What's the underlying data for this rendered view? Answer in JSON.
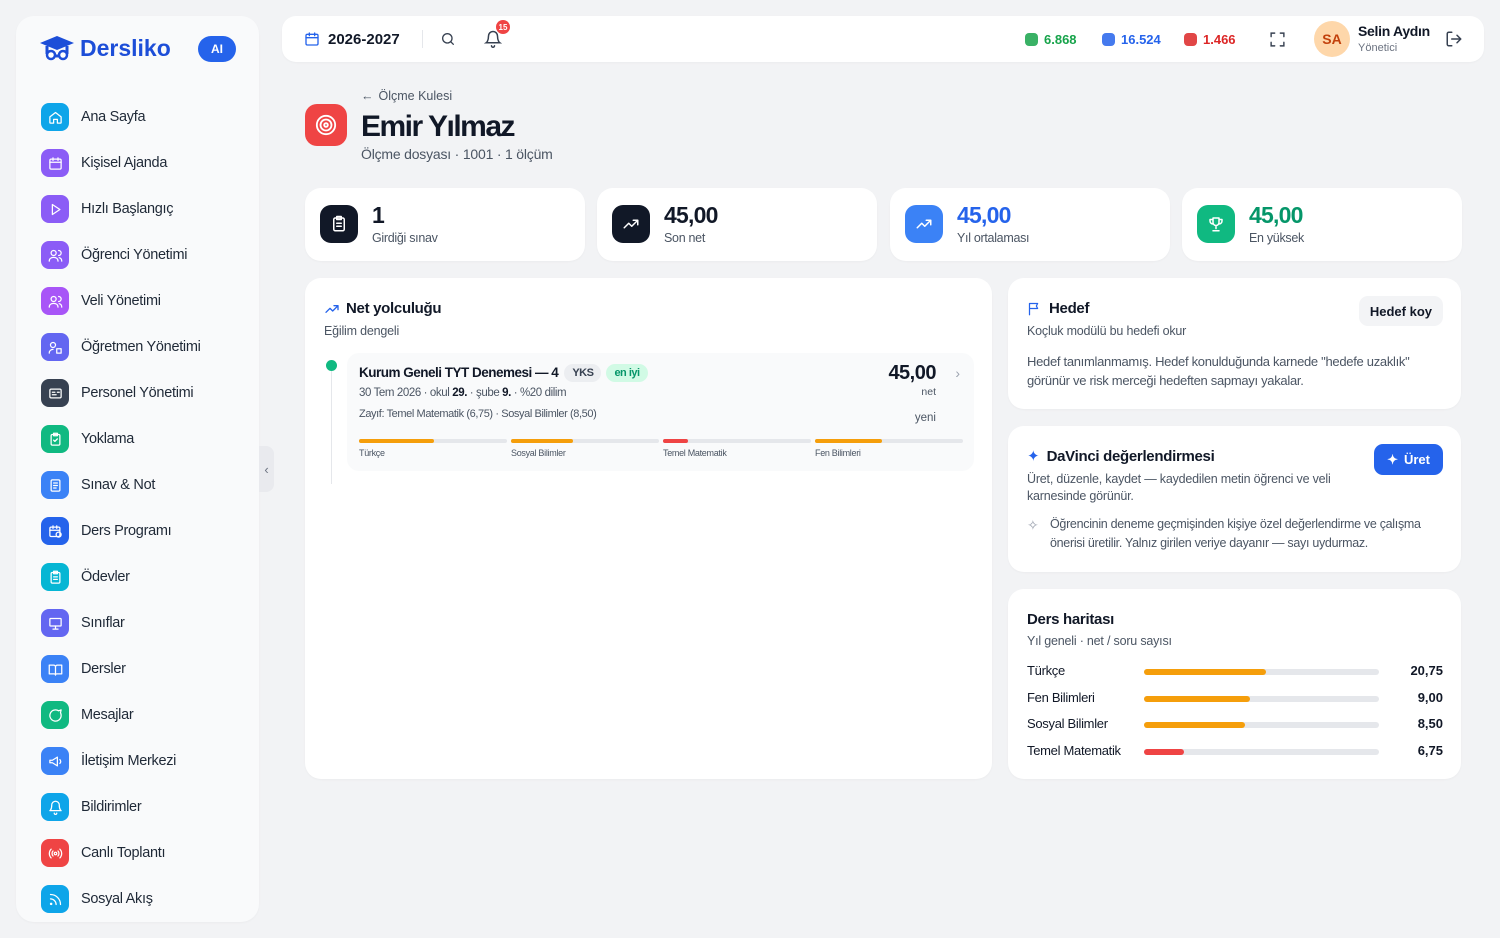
{
  "brand": {
    "name": "Dersliko",
    "ai_label": "AI"
  },
  "sidebar": {
    "items": [
      {
        "label": "Ana Sayfa",
        "icon": "home-icon",
        "color": "#0ea5e9"
      },
      {
        "label": "Kişisel Ajanda",
        "icon": "calendar-icon",
        "color": "#8b5cf6"
      },
      {
        "label": "Hızlı Başlangıç",
        "icon": "play-icon",
        "color": "#8b5cf6"
      },
      {
        "label": "Öğrenci Yönetimi",
        "icon": "users-icon",
        "color": "#8b5cf6"
      },
      {
        "label": "Veli Yönetimi",
        "icon": "users-icon",
        "color": "#a855f7"
      },
      {
        "label": "Öğretmen Yönetimi",
        "icon": "teacher-icon",
        "color": "#6366f1"
      },
      {
        "label": "Personel Yönetimi",
        "icon": "id-card-icon",
        "color": "#374151"
      },
      {
        "label": "Yoklama",
        "icon": "clipboard-check-icon",
        "color": "#10b981"
      },
      {
        "label": "Sınav & Not",
        "icon": "document-icon",
        "color": "#3b82f6"
      },
      {
        "label": "Ders Programı",
        "icon": "calendar-clock-icon",
        "color": "#2563eb"
      },
      {
        "label": "Ödevler",
        "icon": "clipboard-icon",
        "color": "#06b6d4"
      },
      {
        "label": "Sınıflar",
        "icon": "presentation-icon",
        "color": "#6366f1"
      },
      {
        "label": "Dersler",
        "icon": "book-icon",
        "color": "#3b82f6"
      },
      {
        "label": "Mesajlar",
        "icon": "message-icon",
        "color": "#10b981"
      },
      {
        "label": "İletişim Merkezi",
        "icon": "megaphone-icon",
        "color": "#3b82f6"
      },
      {
        "label": "Bildirimler",
        "icon": "bell-icon",
        "color": "#0ea5e9"
      },
      {
        "label": "Canlı Toplantı",
        "icon": "broadcast-icon",
        "color": "#ef4444"
      },
      {
        "label": "Sosyal Akış",
        "icon": "rss-icon",
        "color": "#0ea5e9"
      }
    ]
  },
  "topbar": {
    "year": "2026-2027",
    "notification_count": "15",
    "stats": [
      {
        "value": "6.868",
        "color": "#16a34a",
        "icon": "gem-green-icon"
      },
      {
        "value": "16.524",
        "color": "#2563eb",
        "icon": "gem-blue-icon"
      },
      {
        "value": "1.466",
        "color": "#dc2626",
        "icon": "gem-red-icon"
      }
    ],
    "user": {
      "initials": "SA",
      "name": "Selin Aydın",
      "role": "Yönetici"
    }
  },
  "page": {
    "back_label": "Ölçme Kulesi",
    "title": "Emir Yılmaz",
    "subtitle": "Ölçme dosyası · 1001 · 1 ölçüm"
  },
  "kpis": [
    {
      "value": "1",
      "label": "Girdiği sınav",
      "color": "#111827",
      "icon": "clipboard-icon",
      "value_color": "#111827"
    },
    {
      "value": "45,00",
      "label": "Son net",
      "color": "#111827",
      "icon": "trend-up-icon",
      "value_color": "#111827"
    },
    {
      "value": "45,00",
      "label": "Yıl ortalaması",
      "color": "#3b82f6",
      "icon": "trend-up-icon",
      "value_color": "#2563eb"
    },
    {
      "value": "45,00",
      "label": "En yüksek",
      "color": "#10b981",
      "icon": "trophy-icon",
      "value_color": "#059669"
    }
  ],
  "net_journey": {
    "title": "Net yolculuğu",
    "subtitle": "Eğilim dengeli",
    "exam": {
      "name": "Kurum Geneli TYT Denemesi — 4",
      "tag": "YKS",
      "best_tag": "en iyi",
      "date": "30 Tem 2026 · okul ",
      "school_rank": "29.",
      "branch_prefix": " · şube ",
      "branch_rank": "9.",
      "percentile": " · %20 dilim",
      "weak": "Zayıf: Temel Matematik (6,75) · Sosyal Bilimler (8,50)",
      "net": "45,00",
      "net_label": "net",
      "status": "yeni",
      "subjects": [
        {
          "name": "Türkçe",
          "fill": 0.51,
          "color": "#f59e0b"
        },
        {
          "name": "Sosyal Bilimler",
          "fill": 0.42,
          "color": "#f59e0b"
        },
        {
          "name": "Temel Matematik",
          "fill": 0.17,
          "color": "#ef4444"
        },
        {
          "name": "Fen Bilimleri",
          "fill": 0.45,
          "color": "#f59e0b"
        }
      ]
    }
  },
  "goal": {
    "title": "Hedef",
    "subtitle": "Koçluk modülü bu hedefi okur",
    "button": "Hedef koy",
    "text": "Hedef tanımlanmamış. Hedef konulduğunda karnede \"hedefe uzaklık\" görünür ve risk merceği hedeften sapmayı yakalar."
  },
  "davinci": {
    "title": "DaVinci değerlendirmesi",
    "subtitle": "Üret, düzenle, kaydet — kaydedilen metin öğrenci ve veli karnesinde görünür.",
    "button": "Üret",
    "text": "Öğrencinin deneme geçmişinden kişiye özel değerlendirme ve çalışma önerisi üretilir. Yalnız girilen veriye dayanır — sayı uydurmaz."
  },
  "subject_map": {
    "title": "Ders haritası",
    "subtitle": "Yıl geneli · net / soru sayısı",
    "rows": [
      {
        "label": "Türkçe",
        "value": "20,75",
        "fill": 0.52,
        "color": "#f59e0b"
      },
      {
        "label": "Fen Bilimleri",
        "value": "9,00",
        "fill": 0.45,
        "color": "#f59e0b"
      },
      {
        "label": "Sosyal Bilimler",
        "value": "8,50",
        "fill": 0.43,
        "color": "#f59e0b"
      },
      {
        "label": "Temel Matematik",
        "value": "6,75",
        "fill": 0.17,
        "color": "#ef4444"
      }
    ]
  }
}
